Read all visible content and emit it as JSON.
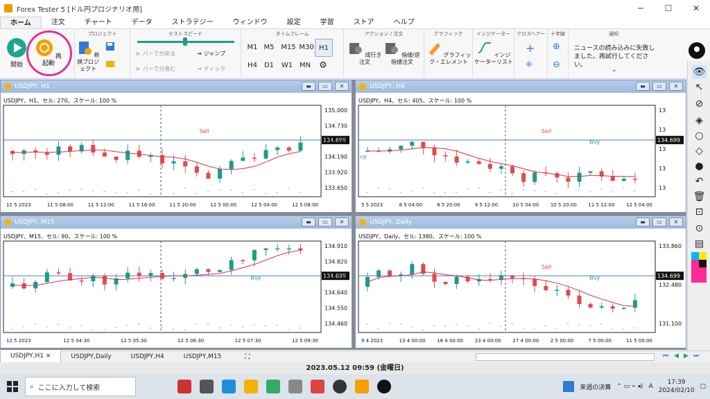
{
  "window": {
    "title": "Forex Tester 5 [ドル円プロジナリオ用]"
  },
  "menu": [
    "ホーム",
    "注文",
    "チャート",
    "データ",
    "ストラテジー",
    "ウィンドウ",
    "設定",
    "学習",
    "ストア",
    "ヘルプ"
  ],
  "ribbon": {
    "start": "開始",
    "restart": "再起動",
    "project_group": "プロジェクト",
    "new_project": "新規プロジェクト",
    "speed_group": "テストスピード",
    "bar_back": "バーで分戻る",
    "bar_forward": "バーで分進む",
    "jump": "ジャンプ",
    "tick": "ティック",
    "timeframe_group": "タイムフレーム",
    "timeframes": [
      "M1",
      "M5",
      "M15",
      "M30",
      "H1",
      "H4",
      "D1",
      "W1",
      "MN"
    ],
    "selected_tf": "H1",
    "action_group": "アクション / 注文",
    "market_order": "成行き注文",
    "limit_order": "指値/逆指値注文",
    "graphic_group": "グラフィック",
    "graphic_element": "グラフィック・エレメント",
    "indicator_group": "インジケーター",
    "indicator_list": "インジケーターリスト",
    "crosshair_group": "クロスヘアー",
    "cross_group": "十字線",
    "notice_group": "通知",
    "notice_text": "ニュースの読み込みに失敗しました。再試行してください。"
  },
  "charts": [
    {
      "id": "h1",
      "title": "USDJPY, H1",
      "info": "USDJPY、H1、セル: 270、スケール: 100 %",
      "price_label": "134.699",
      "yticks": [
        "135.000",
        "134.730",
        "134.460",
        "134.190",
        "133.920",
        "133.650"
      ],
      "xticks": [
        "11 5 2023",
        "11 5 08:00",
        "11 5 12:00",
        "11 5 16:00",
        "11 5 20:00",
        "12 5 00:00",
        "12 5 04:00",
        "12 5 08:00"
      ],
      "sell_label": "Sell"
    },
    {
      "id": "h4",
      "title": "USDJPY, H4",
      "info": "USDJPY、H4、セル: 405、スケール: 100 %",
      "price_label": "134.699",
      "yticks": [
        "13",
        "13",
        "13",
        "13",
        "13"
      ],
      "xticks": [
        "5 5 2023",
        "8 5 04:00",
        "8 5 20:00",
        "9 5 12:00",
        "10 5 04:00",
        "10 5 20:00",
        "11 5 12:00",
        "12 5 04:00"
      ],
      "sell_label": "Sell",
      "buy_label": "Buy",
      "buy_left": "uy"
    },
    {
      "id": "m15",
      "title": "USDJPY, M15",
      "info": "USDJPY、M15、セル: 90、スケール: 100 %",
      "price_label": "134.699",
      "yticks": [
        "134.910",
        "134.820",
        "134.730",
        "134.640",
        "134.550",
        "134.460"
      ],
      "xticks": [
        "12 5 2023",
        "12 5 04:30",
        "12 5 05:30",
        "12 5 06:30",
        "12 5 07:30",
        "12 5 09:30"
      ],
      "buy_label": "Buy"
    },
    {
      "id": "daily",
      "title": "USDJPY, Daily",
      "info": "USDJPY、Daily、セル: 1380、スケール: 100 %",
      "price_label": "134.699",
      "yticks": [
        "133.860",
        "132.480",
        "131.100"
      ],
      "xticks": [
        "9 4 2023",
        "13 4 00:00",
        "18 4 00:00",
        "23 4 00:00",
        "27 4 00:00",
        "2 5 00:00",
        "7 5 00:00",
        "11 5 00:00"
      ],
      "sell_label": "Sell",
      "buy_label": "Buy"
    }
  ],
  "tabs": [
    "USDJPY,H1",
    "USDJPY,Daily",
    "USDJPY,H4",
    "USDJPY,M15"
  ],
  "tab_close": "×",
  "datetime": "2023.05.12 09:59 (金曜日)",
  "taskbar": {
    "search": "ここに入力して検索",
    "weather": "来週の決算",
    "ime": "A",
    "time": "17:39",
    "date": "2024/02/10"
  },
  "colors": {
    "up": "#1f9a8a",
    "down": "#e04b4b",
    "ma": "#d9304a",
    "price_line": "#4a7bd6"
  }
}
